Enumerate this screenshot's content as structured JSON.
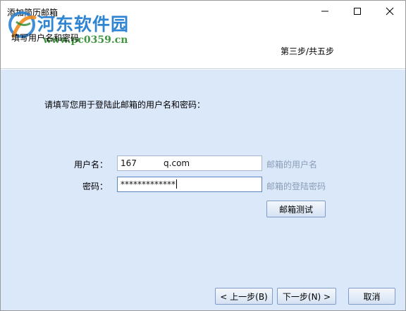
{
  "window": {
    "title": "添加简历邮箱",
    "controls": {
      "minimize": "minimize-icon",
      "maximize": "maximize-icon",
      "close": "close-icon"
    }
  },
  "header": {
    "subtitle": "填写用户名和密码",
    "step": "第三步/共五步"
  },
  "watermark": {
    "name": "河东软件园",
    "url": "www.pc0359.cn"
  },
  "form": {
    "prompt": "请填写您用于登陆此邮箱的用户名和密码：",
    "username_label": "用户名：",
    "username_value": "167          q.com",
    "username_hint": "邮箱的用户名",
    "password_label": "密码：",
    "password_value": "*************",
    "password_hint": "邮箱的登陆密码",
    "test_button": "邮箱测试"
  },
  "footer": {
    "prev_button": "< 上一步(B)",
    "next_button": "下一步(N) >",
    "cancel_button": "取消"
  },
  "colors": {
    "body_bg": "#dbe8fa",
    "watermark_text": "#1e7bcf",
    "watermark_url": "#2c8a2c",
    "hint_text": "#8a9db6"
  }
}
